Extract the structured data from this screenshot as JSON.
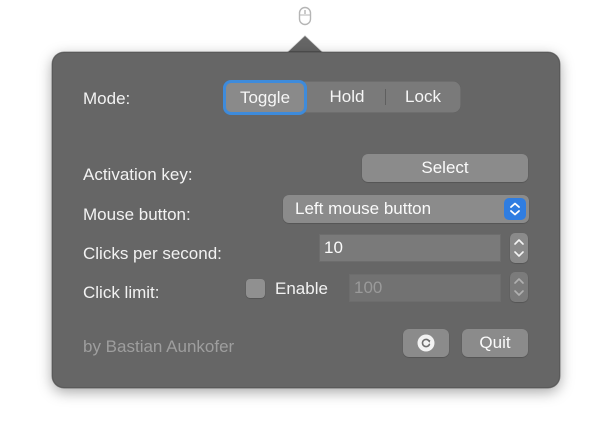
{
  "mode": {
    "label": "Mode:",
    "options": [
      "Toggle",
      "Hold",
      "Lock"
    ],
    "selected": "Toggle"
  },
  "activation_key": {
    "label": "Activation key:",
    "button_label": "Select"
  },
  "mouse_button": {
    "label": "Mouse button:",
    "selected": "Left mouse button"
  },
  "clicks_per_second": {
    "label": "Clicks per second:",
    "value": "10"
  },
  "click_limit": {
    "label": "Click limit:",
    "checkbox_label": "Enable",
    "enabled": false,
    "value": "100"
  },
  "footer": {
    "credit": "by Bastian Aunkofer",
    "quit_label": "Quit"
  },
  "icons": {
    "menubar": "mouse-icon",
    "reset": "refresh-icon",
    "popup": "chevron-up-down-icon",
    "stepper": "stepper-icon"
  },
  "colors": {
    "panel": "#666666",
    "accent": "#2f7de1",
    "focus_ring": "#3e8bdb"
  }
}
